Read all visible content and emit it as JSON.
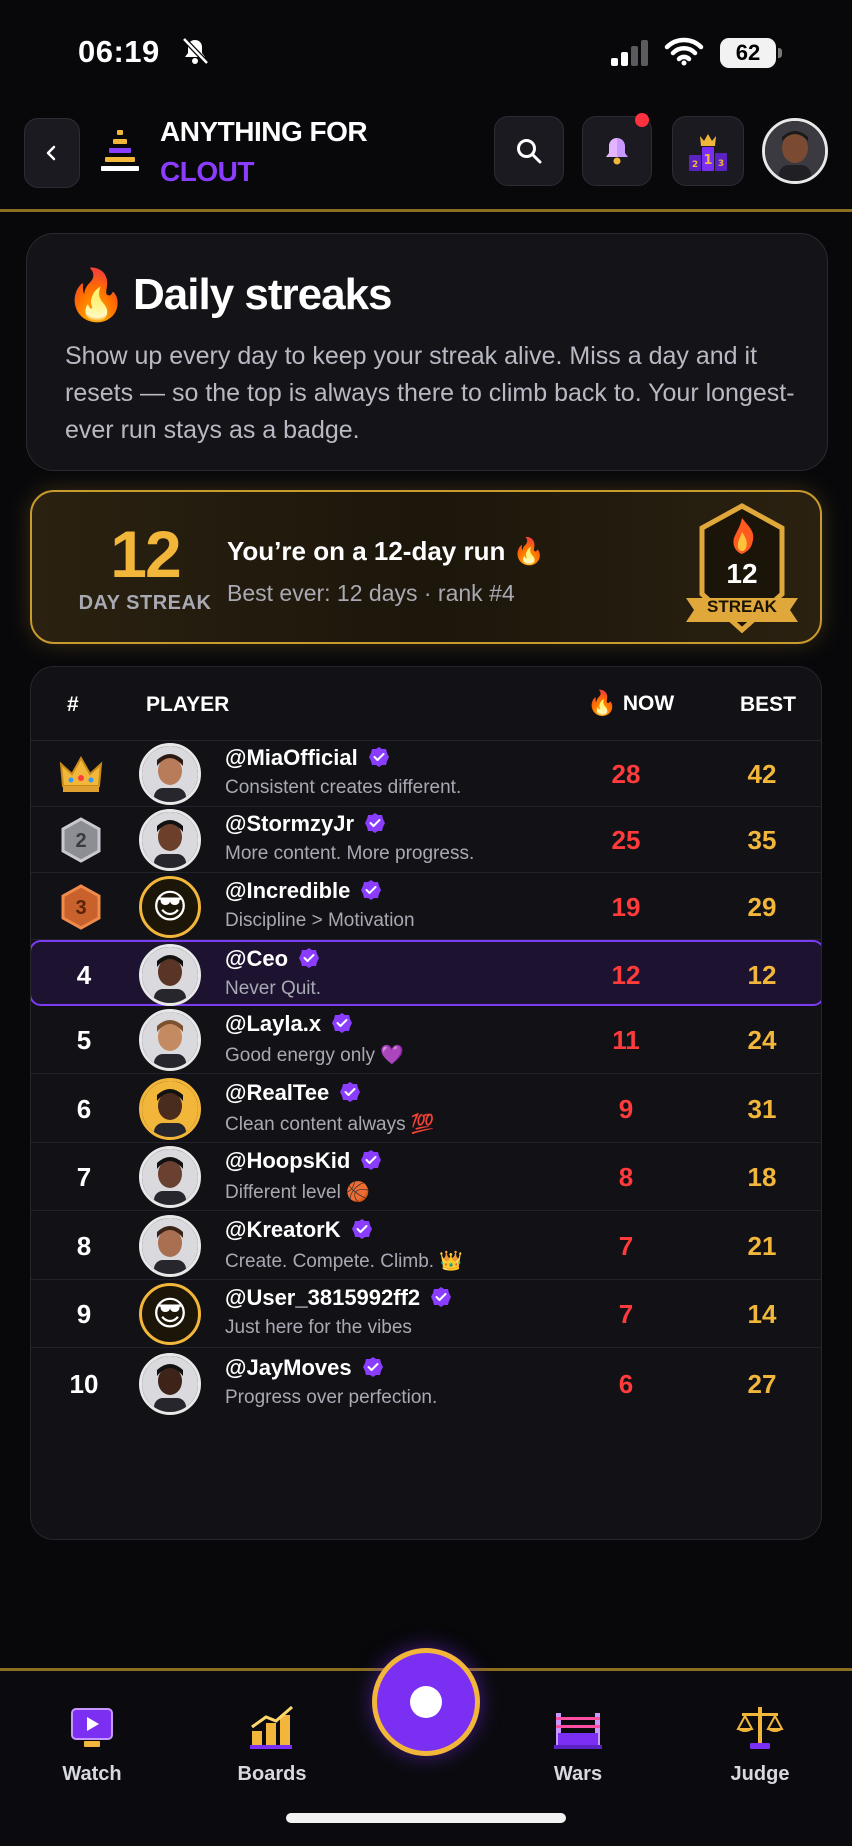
{
  "status": {
    "time": "06:19",
    "battery": "62"
  },
  "header": {
    "brand_line1": "ANYTHING FOR",
    "brand_line2": "CLOUT",
    "brand_accent": "#8b3dff",
    "icons": [
      "back-icon",
      "stack-logo-icon",
      "search-icon",
      "bell-icon",
      "trophy-icon"
    ]
  },
  "intro": {
    "title": "Daily streaks",
    "body": "Show up every day to keep your streak alive. Miss a day and it resets — so the top is always there to climb back to. Your longest-ever run stays as a badge."
  },
  "streak": {
    "value": "12",
    "label": "DAY STREAK",
    "headline": "You’re on a 12-day run 🔥",
    "subline": "Best ever: 12 days · rank #4",
    "badge_value": "12",
    "badge_label": "STREAK"
  },
  "board": {
    "headers": {
      "rank": "#",
      "player": "PLAYER",
      "now": "NOW",
      "best": "BEST"
    },
    "rows": [
      {
        "rank": "1",
        "rank_icon": "crown-icon",
        "handle": "@MiaOfficial",
        "bio": "Consistent creates different.",
        "now": "28",
        "best": "42"
      },
      {
        "rank": "2",
        "rank_icon": "silver-medal-icon",
        "handle": "@StormzyJr",
        "bio": "More content. More progress.",
        "now": "25",
        "best": "35"
      },
      {
        "rank": "3",
        "rank_icon": "bronze-medal-icon",
        "handle": "@Incredible",
        "bio": "Discipline > Motivation",
        "now": "19",
        "best": "29"
      },
      {
        "rank": "4",
        "handle": "@Ceo",
        "bio": "Never Quit.",
        "now": "12",
        "best": "12",
        "highlight": true
      },
      {
        "rank": "5",
        "handle": "@Layla.x",
        "bio": "Good energy only 💜",
        "now": "11",
        "best": "24"
      },
      {
        "rank": "6",
        "handle": "@RealTee",
        "bio": "Clean content always 💯",
        "now": "9",
        "best": "31"
      },
      {
        "rank": "7",
        "handle": "@HoopsKid",
        "bio": "Different level 🏀",
        "now": "8",
        "best": "18"
      },
      {
        "rank": "8",
        "handle": "@KreatorK",
        "bio": "Create. Compete. Climb. 👑",
        "now": "7",
        "best": "21"
      },
      {
        "rank": "9",
        "handle": "@User_3815992ff2",
        "bio": "Just here for the vibes",
        "now": "7",
        "best": "14"
      },
      {
        "rank": "10",
        "handle": "@JayMoves",
        "bio": "Progress over perfection.",
        "now": "6",
        "best": "27"
      }
    ]
  },
  "nav": {
    "watch": "Watch",
    "boards": "Boards",
    "wars": "Wars",
    "judge": "Judge"
  },
  "colors": {
    "gold": "#f2b63a",
    "now_red": "#ff3b3b",
    "purple": "#7b2ff2"
  }
}
